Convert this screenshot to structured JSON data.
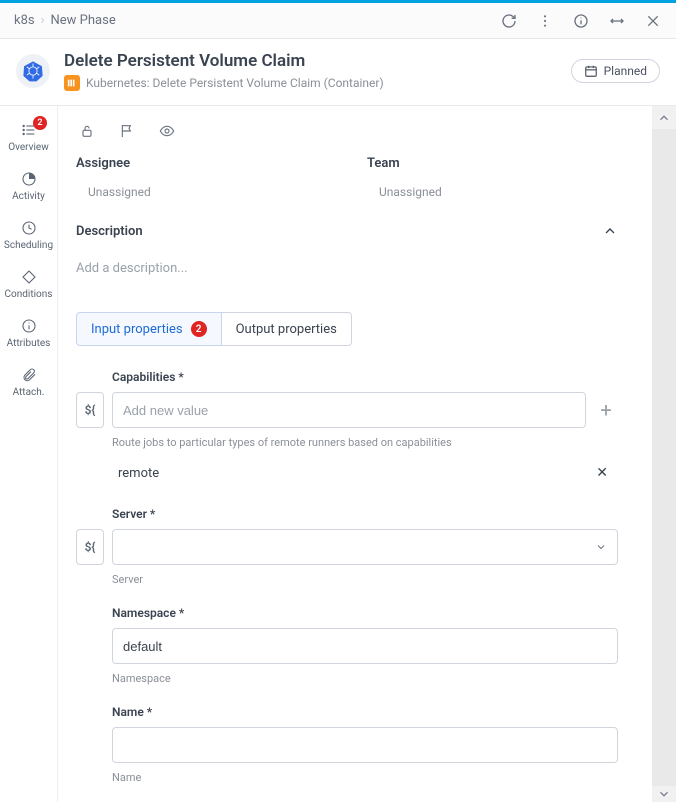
{
  "breadcrumb": {
    "root": "k8s",
    "current": "New Phase"
  },
  "title": "Delete Persistent Volume Claim",
  "subtitle": "Kubernetes: Delete Persistent Volume Claim (Container)",
  "status": "Planned",
  "sidebar": {
    "items": [
      {
        "label": "Overview",
        "badge": "2"
      },
      {
        "label": "Activity"
      },
      {
        "label": "Scheduling"
      },
      {
        "label": "Conditions"
      },
      {
        "label": "Attributes"
      },
      {
        "label": "Attach."
      }
    ]
  },
  "assignee": {
    "label": "Assignee",
    "value": "Unassigned"
  },
  "team": {
    "label": "Team",
    "value": "Unassigned"
  },
  "description": {
    "label": "Description",
    "placeholder": "Add a description..."
  },
  "tabs": {
    "input": {
      "label": "Input properties",
      "badge": "2"
    },
    "output": {
      "label": "Output properties"
    }
  },
  "fields": {
    "capabilities": {
      "label": "Capabilities *",
      "placeholder": "Add new value",
      "help": "Route jobs to particular types of remote runners based on capabilities",
      "chip": "remote"
    },
    "server": {
      "label": "Server *",
      "help": "Server",
      "value": ""
    },
    "namespace": {
      "label": "Namespace *",
      "value": "default",
      "help": "Namespace"
    },
    "name": {
      "label": "Name *",
      "value": "",
      "help": "Name"
    }
  },
  "var_btn_label": "${"
}
